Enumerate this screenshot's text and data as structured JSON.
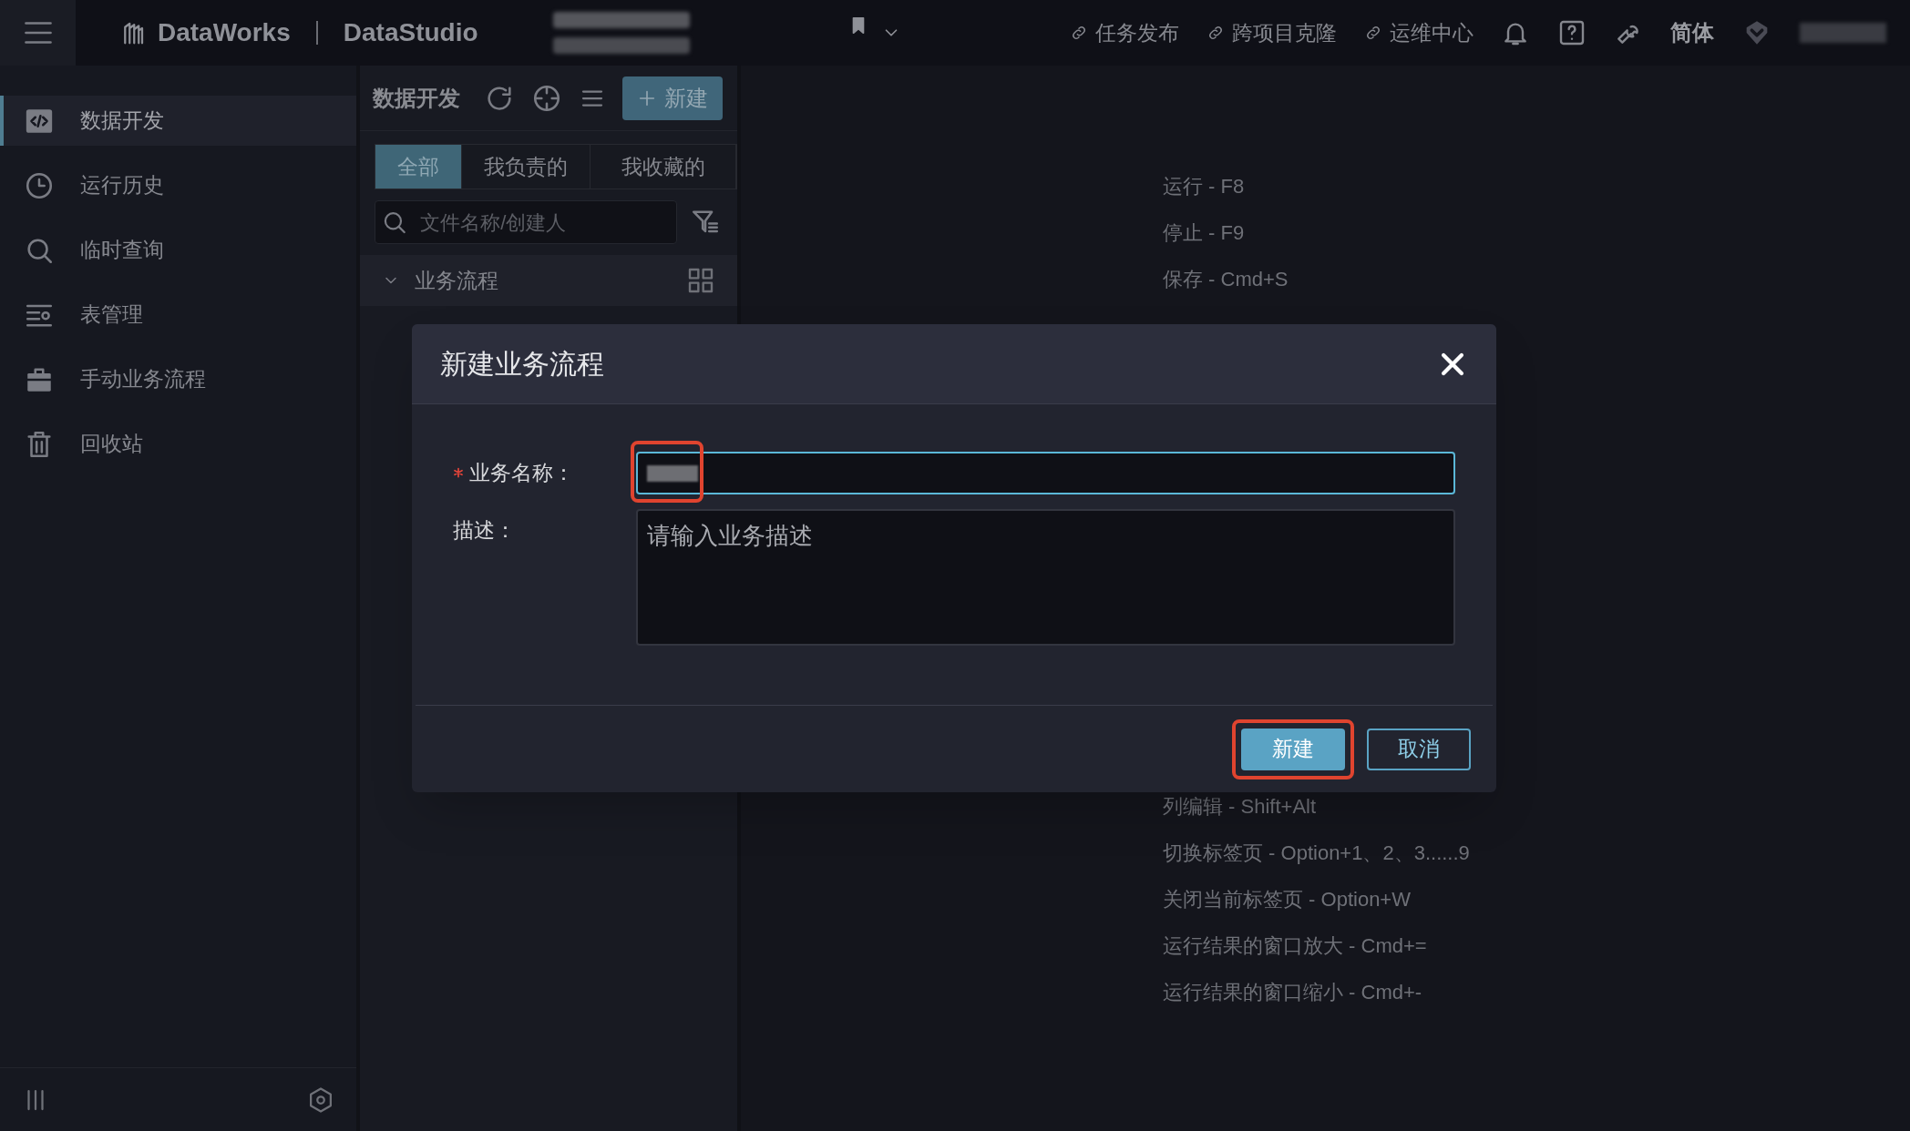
{
  "topbar": {
    "logo": "DataWorks",
    "product": "DataStudio",
    "links": [
      {
        "label": "任务发布"
      },
      {
        "label": "跨项目克隆"
      },
      {
        "label": "运维中心"
      }
    ],
    "language": {
      "label": "简体",
      "selected": true
    }
  },
  "sidebar": {
    "items": [
      {
        "label": "数据开发",
        "selected": true
      },
      {
        "label": "运行历史",
        "selected": false
      },
      {
        "label": "临时查询",
        "selected": false
      },
      {
        "label": "表管理",
        "selected": false
      },
      {
        "label": "手动业务流程",
        "selected": false
      },
      {
        "label": "回收站",
        "selected": false
      }
    ]
  },
  "panel": {
    "title": "数据开发",
    "new_button": "新建",
    "tabs": [
      {
        "label": "全部",
        "selected": true
      },
      {
        "label": "我负责的",
        "selected": false
      },
      {
        "label": "我收藏的",
        "selected": false
      }
    ],
    "search": {
      "placeholder": "文件名称/创建人"
    },
    "folders": [
      {
        "label": "业务流程",
        "expanded": true
      }
    ]
  },
  "shortcuts": {
    "above_dialog": [
      {
        "label": "运行 - F8"
      },
      {
        "label": "停止 - F9"
      },
      {
        "label": "保存 - Cmd+S"
      }
    ],
    "below_dialog": [
      {
        "label": "列编辑 - Shift+Alt"
      },
      {
        "label": "切换标签页 - Option+1、2、3......9"
      },
      {
        "label": "关闭当前标签页 - Option+W"
      },
      {
        "label": "运行结果的窗口放大 - Cmd+="
      },
      {
        "label": "运行结果的窗口缩小 - Cmd+-"
      }
    ]
  },
  "dialog": {
    "title": "新建业务流程",
    "fields": [
      {
        "kind": "input",
        "label": "业务名称：",
        "required": true,
        "highlighted": true
      },
      {
        "kind": "textarea",
        "label": "描述：",
        "required": false,
        "highlighted": false,
        "placeholder": "请输入业务描述"
      }
    ],
    "buttons": [
      {
        "label": "新建",
        "primary": true,
        "highlighted": true
      },
      {
        "label": "取消",
        "primary": false,
        "highlighted": false
      }
    ]
  }
}
